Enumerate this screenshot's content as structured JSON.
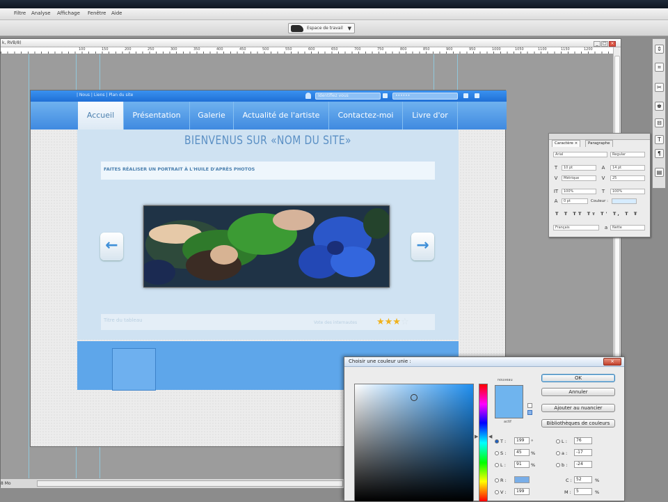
{
  "menubar": {
    "items": [
      "Filtre",
      "Analyse",
      "Affichage",
      "Fenêtre",
      "Aide"
    ]
  },
  "options_bar": {
    "workspace": "Espace de travail"
  },
  "document": {
    "title": "k, RVB/8)",
    "zoom": "8 Mo",
    "ruler_marks": [
      "100",
      "150",
      "200",
      "250",
      "300",
      "350",
      "400",
      "450",
      "500",
      "550",
      "600",
      "650",
      "700",
      "750",
      "800",
      "850",
      "900",
      "950",
      "1000",
      "1050",
      "1100",
      "1150",
      "1200"
    ]
  },
  "website": {
    "topbar_links": "| Nous | Liens | Plan du site",
    "search_placeholder": "Identifiez vous",
    "password_placeholder": "••••••",
    "nav": [
      "Accueil",
      "Présentation",
      "Galerie",
      "Actualité de l'artiste",
      "Contactez-moi",
      "Livre d'or"
    ],
    "active_nav": "Accueil",
    "welcome": "BIENVENUS SUR «NOM DU SITE»",
    "subtitle": "FAITES RÉALISER UN PORTRAIT À L'HUILE D'APRÈS PHOTOS",
    "caption_left": "Titre du tableau",
    "caption_right": "Vote des internautes",
    "stars_filled": "★★★",
    "stars_empty": "☆",
    "arrow_left": "←",
    "arrow_right": "→"
  },
  "character_panel": {
    "tabs": [
      "Caractère ×",
      "Paragraphe"
    ],
    "font": "Arial",
    "style": "Regular",
    "size": "10 pt",
    "leading": "14 pt",
    "kerning": "Métrique",
    "tracking": "25",
    "vscale": "100%",
    "hscale": "100%",
    "baseline": "0 pt",
    "color_label": "Couleur :",
    "language": "Français",
    "aa": "Nette",
    "style_buttons": [
      "T",
      "T",
      "TT",
      "Tт",
      "T'",
      "T,",
      "T",
      "Ŧ"
    ]
  },
  "color_picker": {
    "title": "Choisir une couleur unie :",
    "close": "×",
    "new_label": "nouveau",
    "current_label": "actif",
    "buttons": [
      "OK",
      "Annuler",
      "Ajouter au nuancier",
      "Bibliothèques de couleurs"
    ],
    "hsb": [
      {
        "label": "T :",
        "value": "199",
        "unit": "°",
        "on": true
      },
      {
        "label": "S :",
        "value": "45",
        "unit": "%",
        "on": false
      },
      {
        "label": "L :",
        "value": "91",
        "unit": "%",
        "on": false
      },
      {
        "label": "R :",
        "value": "",
        "unit": "",
        "on": false
      },
      {
        "label": "V :",
        "value": "199",
        "unit": "",
        "on": false
      }
    ],
    "lab": [
      {
        "label": "L :",
        "value": "76"
      },
      {
        "label": "a :",
        "value": "-17"
      },
      {
        "label": "b :",
        "value": "-24"
      }
    ],
    "cmyk": [
      {
        "label": "C :",
        "value": "52",
        "unit": "%"
      },
      {
        "label": "M :",
        "value": "5",
        "unit": "%"
      }
    ],
    "swatch_color": "#6fb4ee"
  },
  "tools": {
    "icons": [
      "⇕",
      "⌗",
      "✂",
      "♚",
      "⊟",
      "T",
      "¶",
      "▤"
    ]
  }
}
